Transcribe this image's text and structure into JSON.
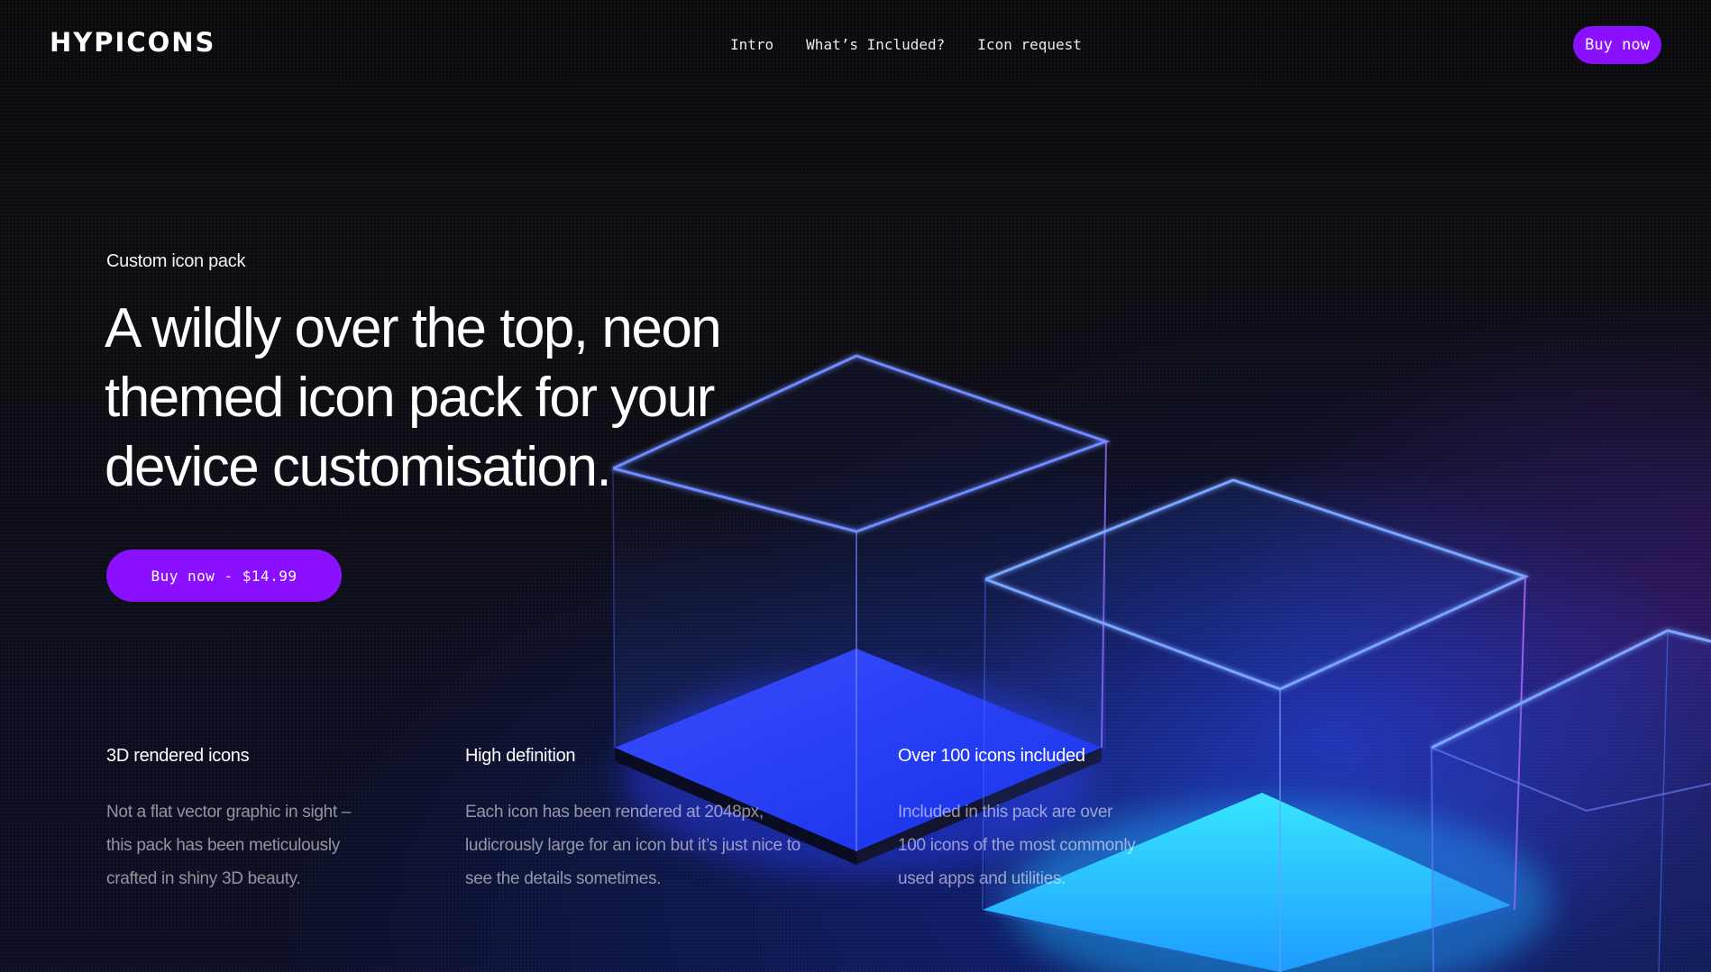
{
  "header": {
    "logo": "HYPICONS",
    "nav": [
      {
        "label": "Intro"
      },
      {
        "label": "What’s Included?"
      },
      {
        "label": "Icon request"
      }
    ],
    "buy_label": "Buy now"
  },
  "hero": {
    "eyebrow": "Custom icon pack",
    "headline": "A wildly over the top, neon themed icon pack for your device customisation.",
    "cta_label": "Buy now - $14.99"
  },
  "features": [
    {
      "title": "3D rendered icons",
      "body": "Not a flat vector graphic in sight – this pack has been meticulously crafted in shiny 3D beauty."
    },
    {
      "title": "High definition",
      "body": "Each icon has been rendered at 2048px, ludicrously large for an icon but it’s just nice to see the details sometimes."
    },
    {
      "title": "Over 100 icons included",
      "body": "Included in this pack are over 100 icons of the most commonly used apps and utilities."
    }
  ],
  "colors": {
    "accent": "#8b10ff",
    "background": "#0a0a0d",
    "glow_blue": "#2a5cff",
    "glow_cyan": "#27d6ff"
  }
}
